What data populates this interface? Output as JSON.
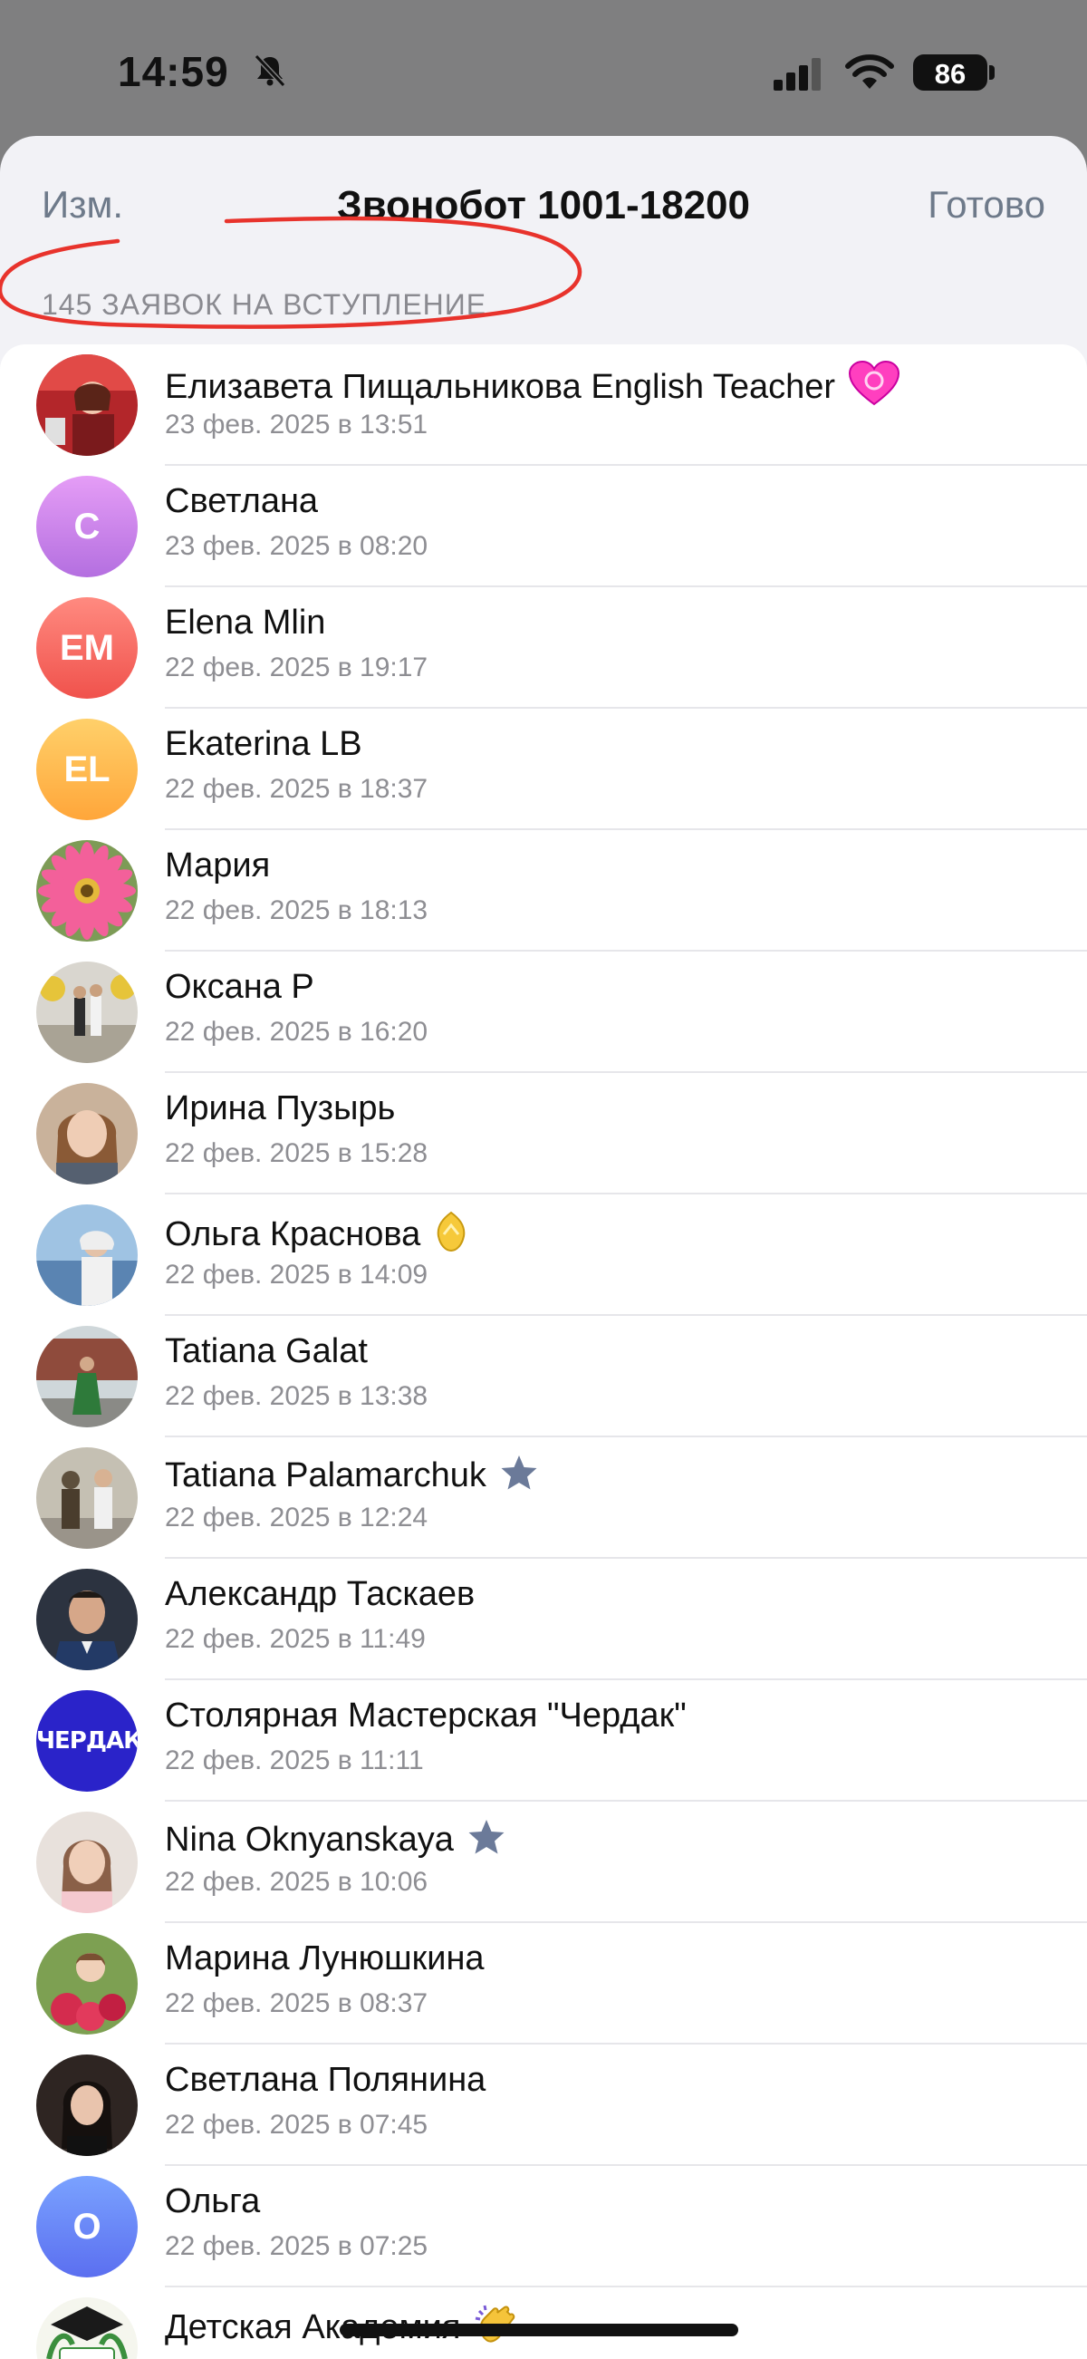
{
  "status": {
    "time": "14:59",
    "battery": "86"
  },
  "nav": {
    "edit_label": "Изм.",
    "title": "Звонобот 1001-18200",
    "done_label": "Готово"
  },
  "section_header": "145 ЗАЯВОК НА ВСТУПЛЕНИЕ",
  "colors": {
    "accent_gray": "#6e7a8a",
    "annotation_red": "#e8332c",
    "star": "#6b7a99"
  },
  "requests": [
    {
      "name": "Елизавета Пищальникова English Teacher",
      "date": "23 фев. 2025 в 13:51",
      "avatar": "photo-red",
      "badge": "heart-icon"
    },
    {
      "name": "Светлана",
      "date": "23 фев. 2025 в 08:20",
      "avatar": "initials",
      "initials": "С"
    },
    {
      "name": "Elena Mlin",
      "date": "22 фев. 2025 в 19:17",
      "avatar": "initials",
      "initials": "EM"
    },
    {
      "name": "Ekaterina LB",
      "date": "22 фев. 2025 в 18:37",
      "avatar": "initials",
      "initials": "EL"
    },
    {
      "name": "Мария",
      "date": "22 фев. 2025 в 18:13",
      "avatar": "photo-flower"
    },
    {
      "name": "Оксана Р",
      "date": "22 фев. 2025 в 16:20",
      "avatar": "photo-event"
    },
    {
      "name": "Ирина Пузырь",
      "date": "22 фев. 2025 в 15:28",
      "avatar": "photo-portrait"
    },
    {
      "name": "Ольга Краснова",
      "date": "22 фев. 2025 в 14:09",
      "avatar": "photo-sea",
      "badge": "crown-icon"
    },
    {
      "name": "Tatiana Galat",
      "date": "22 фев. 2025 в 13:38",
      "avatar": "photo-street"
    },
    {
      "name": "Tatiana Palamarchuk",
      "date": "22 фев. 2025 в 12:24",
      "avatar": "photo-statue",
      "badge": "star-icon"
    },
    {
      "name": "Александр Таскаев",
      "date": "22 фев. 2025 в 11:49",
      "avatar": "photo-man"
    },
    {
      "name": "Столярная Мастерская \"Чердак\"",
      "date": "22 фев. 2025 в 11:11",
      "avatar": "logo-cherdak",
      "logo_text": "ЧЕРДАК"
    },
    {
      "name": "Nina Oknyanskaya",
      "date": "22 фев. 2025 в 10:06",
      "avatar": "photo-woman",
      "badge": "star-icon"
    },
    {
      "name": "Марина Лунюшкина",
      "date": "22 фев. 2025 в 08:37",
      "avatar": "photo-roses"
    },
    {
      "name": "Светлана Полянина",
      "date": "22 фев. 2025 в 07:45",
      "avatar": "photo-dark"
    },
    {
      "name": "Ольга",
      "date": "22 фев. 2025 в 07:25",
      "avatar": "initials",
      "initials": "О"
    },
    {
      "name": "Детская Академия",
      "date": "",
      "avatar": "logo-academy",
      "badge": "clap-icon"
    }
  ]
}
